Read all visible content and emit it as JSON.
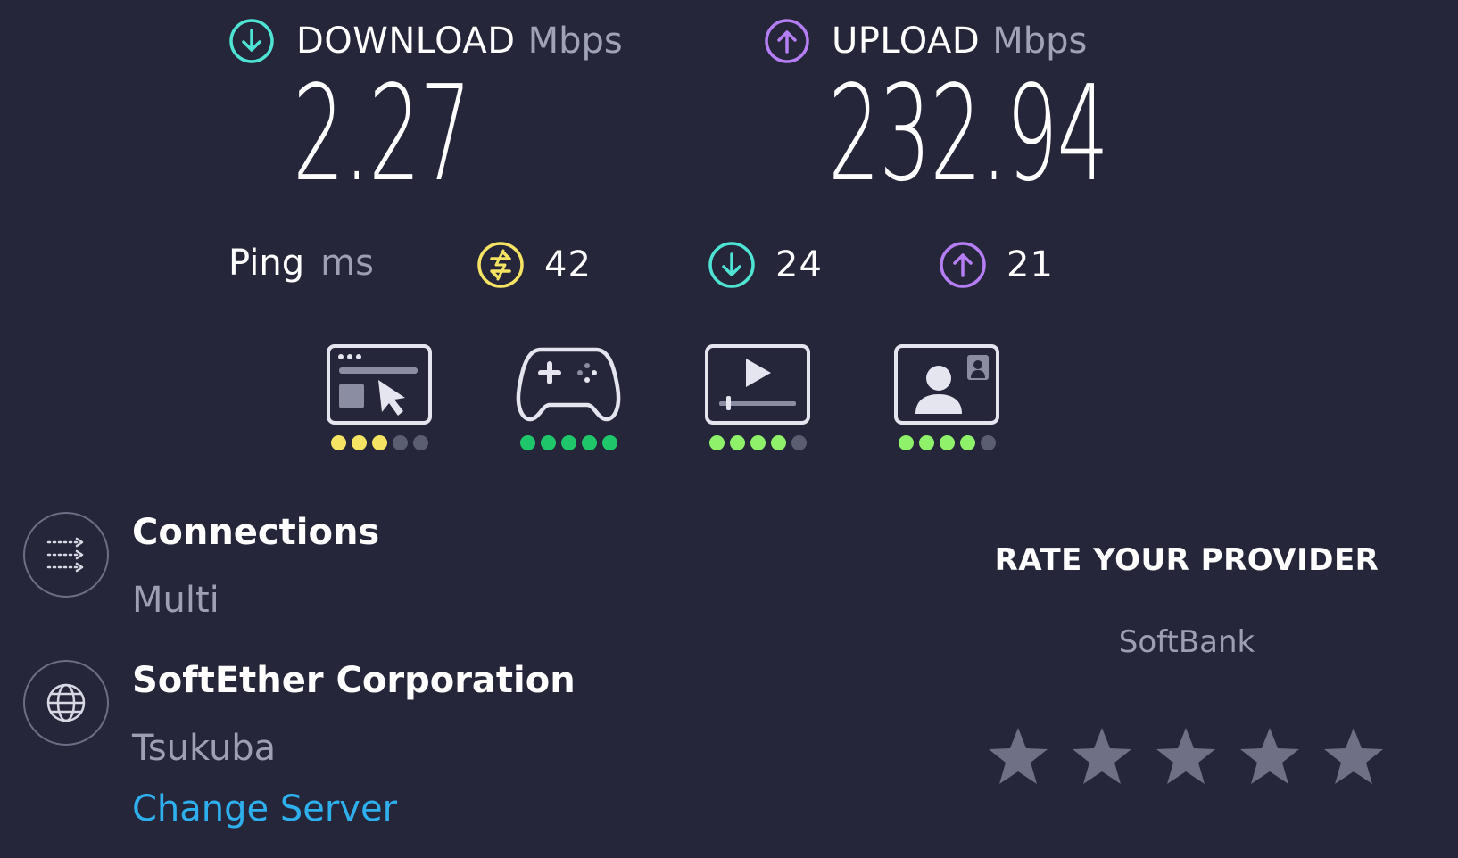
{
  "download": {
    "label": "DOWNLOAD",
    "unit": "Mbps",
    "value": "2.27",
    "icon": "arrow-down-circle-icon",
    "color": "#4fe3d4"
  },
  "upload": {
    "label": "UPLOAD",
    "unit": "Mbps",
    "value": "232.94",
    "icon": "arrow-up-circle-icon",
    "color": "#b57ef5"
  },
  "ping": {
    "label": "Ping",
    "unit": "ms",
    "idle": {
      "value": "42",
      "icon": "ping-idle-icon",
      "color": "#f5e463"
    },
    "download": {
      "value": "24",
      "icon": "arrow-down-circle-icon",
      "color": "#4fe3d4"
    },
    "upload": {
      "value": "21",
      "icon": "arrow-up-circle-icon",
      "color": "#b57ef5"
    }
  },
  "quality": [
    {
      "icon": "web-browsing-icon",
      "rating": 3,
      "max": 5,
      "color": "#f5e463"
    },
    {
      "icon": "gaming-icon",
      "rating": 5,
      "max": 5,
      "color": "#1fc76a"
    },
    {
      "icon": "video-streaming-icon",
      "rating": 4,
      "max": 5,
      "color": "#8ff06a"
    },
    {
      "icon": "video-chat-icon",
      "rating": 4,
      "max": 5,
      "color": "#8ff06a"
    }
  ],
  "connections": {
    "title": "Connections",
    "value": "Multi",
    "icon": "connections-icon"
  },
  "server": {
    "title": "SoftEther Corporation",
    "location": "Tsukuba",
    "icon": "globe-icon",
    "change_label": "Change Server"
  },
  "rate": {
    "title": "RATE YOUR PROVIDER",
    "provider": "SoftBank",
    "stars": 5,
    "filled": 0,
    "star_color": "#6f7085"
  }
}
